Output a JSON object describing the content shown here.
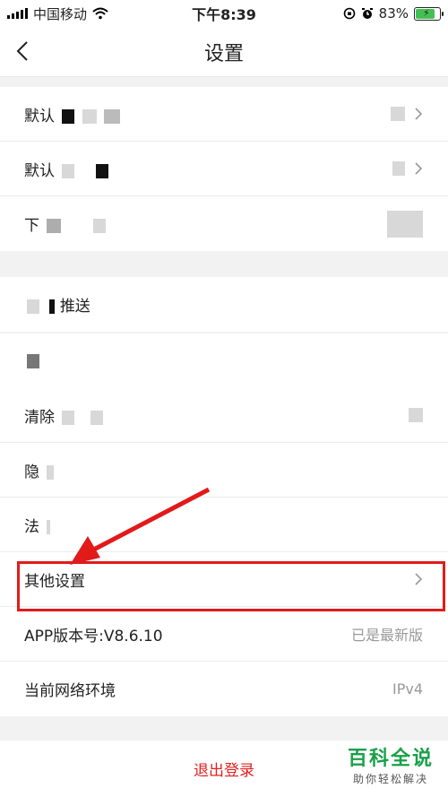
{
  "status_bar": {
    "carrier": "中国移动",
    "time": "下午8:39",
    "battery_percent": "83%",
    "battery_level": 0.83
  },
  "nav": {
    "title": "设置",
    "back_icon": "chevron-left-icon"
  },
  "group1": {
    "items": [
      {
        "label": "默认"
      },
      {
        "label": "默认"
      },
      {
        "label": "下"
      }
    ]
  },
  "group2": {
    "items": [
      {
        "label": "推送"
      }
    ]
  },
  "group3": {
    "items": [
      {
        "label": "清除"
      },
      {
        "label": "隐"
      },
      {
        "label": "法"
      },
      {
        "label": "其他设置"
      },
      {
        "label": "APP版本号:V8.6.10",
        "value": "已是最新版"
      },
      {
        "label": "当前网络环境",
        "value": "IPv4"
      }
    ]
  },
  "logout": {
    "label": "退出登录"
  },
  "watermark": {
    "title": "百科全说",
    "subtitle": "助你轻松解决"
  },
  "colors": {
    "accent_red": "#e02020",
    "highlight_red": "#e21a1a",
    "watermark_green": "#1aa04a"
  }
}
